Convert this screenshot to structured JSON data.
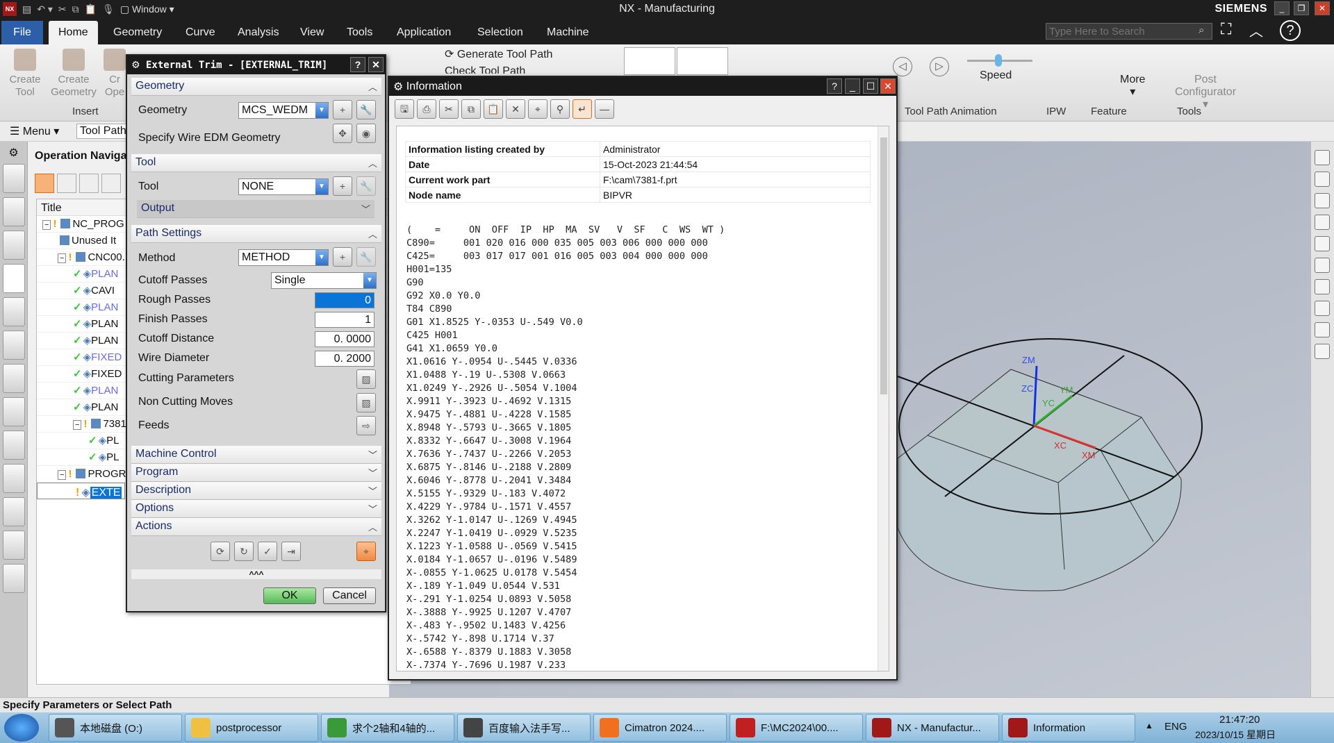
{
  "window": {
    "title": "NX - Manufacturing",
    "brand": "SIEMENS",
    "quick_access_window": "Window"
  },
  "menu_tabs": [
    "File",
    "Home",
    "Geometry",
    "Curve",
    "Analysis",
    "View",
    "Tools",
    "Application",
    "Selection",
    "Machine"
  ],
  "active_tab": "Home",
  "search": {
    "placeholder": "Type Here to Search"
  },
  "ribbon": {
    "create_tool": "Create Tool",
    "create_geometry": "Create Geometry",
    "create_operation": "Cr Ope",
    "insert_group": "Insert",
    "generate_tool_path": "Generate Tool Path",
    "check_tool_path": "Check Tool Path",
    "speed": "Speed",
    "more": "More",
    "post_configurator": "Post Configurator",
    "groups": {
      "animation": "Tool Path Animation",
      "ipw": "IPW",
      "feature": "Feature",
      "tools": "Tools"
    }
  },
  "menubar": {
    "menu": "Menu",
    "filter": "Tool Path"
  },
  "navigator": {
    "title": "Operation Naviga",
    "column": "Title",
    "rows": [
      {
        "label": "NC_PROG",
        "indent": 0,
        "type": "folder",
        "status": "warn"
      },
      {
        "label": "Unused It",
        "indent": 1,
        "type": "folder",
        "status": ""
      },
      {
        "label": "CNC00.",
        "indent": 1,
        "type": "folder",
        "status": "warn"
      },
      {
        "label": "PLAN",
        "indent": 2,
        "type": "op",
        "status": "ok",
        "color": "blue"
      },
      {
        "label": "CAVI",
        "indent": 2,
        "type": "op",
        "status": "ok",
        "color": ""
      },
      {
        "label": "PLAN",
        "indent": 2,
        "type": "op",
        "status": "ok",
        "color": "blue"
      },
      {
        "label": "PLAN",
        "indent": 2,
        "type": "op",
        "status": "ok",
        "color": ""
      },
      {
        "label": "PLAN",
        "indent": 2,
        "type": "op",
        "status": "ok",
        "color": ""
      },
      {
        "label": "FIXED",
        "indent": 2,
        "type": "op",
        "status": "ok",
        "color": "blue"
      },
      {
        "label": "FIXED",
        "indent": 2,
        "type": "op",
        "status": "ok",
        "color": ""
      },
      {
        "label": "PLAN",
        "indent": 2,
        "type": "op",
        "status": "ok",
        "color": "blue"
      },
      {
        "label": "PLAN",
        "indent": 2,
        "type": "op",
        "status": "ok",
        "color": ""
      },
      {
        "label": "7381",
        "indent": 2,
        "type": "folder",
        "status": "warn"
      },
      {
        "label": "PL",
        "indent": 3,
        "type": "op",
        "status": "ok",
        "color": ""
      },
      {
        "label": "PL",
        "indent": 3,
        "type": "op",
        "status": "ok",
        "color": ""
      },
      {
        "label": "PROGRA",
        "indent": 1,
        "type": "folder",
        "status": "warn"
      },
      {
        "label": "EXTE",
        "indent": 2,
        "type": "op",
        "status": "warn",
        "color": "selected"
      }
    ]
  },
  "trim_dialog": {
    "title": "External Trim - [EXTERNAL_TRIM]",
    "sections": {
      "geometry": "Geometry",
      "tool": "Tool",
      "path_settings": "Path Settings",
      "machine_control": "Machine Control",
      "program": "Program",
      "description": "Description",
      "options": "Options",
      "actions": "Actions"
    },
    "geometry_label": "Geometry",
    "geometry_value": "MCS_WEDM",
    "specify_wire": "Specify Wire EDM Geometry",
    "tool_label": "Tool",
    "tool_value": "NONE",
    "output": "Output",
    "method_label": "Method",
    "method_value": "METHOD",
    "cutoff_passes_label": "Cutoff Passes",
    "cutoff_passes_value": "Single",
    "rough_passes_label": "Rough Passes",
    "rough_passes_value": "0",
    "finish_passes_label": "Finish Passes",
    "finish_passes_value": "1",
    "cutoff_distance_label": "Cutoff Distance",
    "cutoff_distance_value": "0. 0000",
    "wire_diameter_label": "Wire Diameter",
    "wire_diameter_value": "0. 2000",
    "cutting_parameters": "Cutting Parameters",
    "non_cutting_moves": "Non Cutting Moves",
    "feeds": "Feeds",
    "ok": "OK",
    "cancel": "Cancel"
  },
  "info_window": {
    "title": "Information",
    "header": [
      {
        "key": "Information listing created by",
        "value": "Administrator"
      },
      {
        "key": "Date",
        "value": "15-Oct-2023 21:44:54"
      },
      {
        "key": "Current work part",
        "value": "F:\\cam\\7381-f.prt"
      },
      {
        "key": "Node name",
        "value": "BIPVR"
      }
    ],
    "lines": [
      "(    =     ON  OFF  IP  HP  MA  SV   V  SF   C  WS  WT )",
      "C890=     001 020 016 000 035 005 003 006 000 000 000",
      "C425=     003 017 017 001 016 005 003 004 000 000 000",
      "H001=135",
      "G90",
      "G92 X0.0 Y0.0",
      "T84 C890",
      "G01 X1.8525 Y-.0353 U-.549 V0.0",
      "C425 H001",
      "G41 X1.0659 Y0.0",
      "X1.0616 Y-.0954 U-.5445 V.0336",
      "X1.0488 Y-.19 U-.5308 V.0663",
      "X1.0249 Y-.2926 U-.5054 V.1004",
      "X.9911 Y-.3923 U-.4692 V.1315",
      "X.9475 Y-.4881 U-.4228 V.1585",
      "X.8948 Y-.5793 U-.3665 V.1805",
      "X.8332 Y-.6647 U-.3008 V.1964",
      "X.7636 Y-.7437 U-.2266 V.2053",
      "X.6875 Y-.8146 U-.2188 V.2809",
      "X.6046 Y-.8778 U-.2041 V.3484",
      "X.5155 Y-.9329 U-.183 V.4072",
      "X.4229 Y-.9784 U-.1571 V.4557",
      "X.3262 Y-1.0147 U-.1269 V.4945",
      "X.2247 Y-1.0419 U-.0929 V.5235",
      "X.1223 Y-1.0588 U-.0569 V.5415",
      "X.0184 Y-1.0657 U-.0196 V.5489",
      "X-.0855 Y-1.0625 U.0178 V.5454",
      "X-.189 Y-1.049 U.0544 V.531",
      "X-.291 Y-1.0254 U.0893 V.5058",
      "X-.3888 Y-.9925 U.1207 V.4707",
      "X-.483 Y-.9502 U.1483 V.4256",
      "X-.5742 Y-.898 U.1714 V.37",
      "X-.6588 Y-.8379 U.1883 V.3058",
      "X-.7374 Y-.7696 U.1987 V.233"
    ]
  },
  "viewport": {
    "axes": {
      "zm": "ZM",
      "zc": "ZC",
      "yc": "YC",
      "ym": "YM",
      "xc": "XC",
      "xm": "XM"
    }
  },
  "status": "Specify Parameters or Select Path",
  "taskbar": {
    "items": [
      "本地磁盘 (O:)",
      "postprocessor",
      "求个2轴和4轴的...",
      "百度输入法手写...",
      "Cimatron 2024....",
      "F:\\MC2024\\00....",
      "NX - Manufactur...",
      "Information"
    ],
    "lang": "ENG",
    "time": "21:47:20",
    "date": "2023/10/15 星期日"
  },
  "colors": {
    "accent": "#0a74d8",
    "file_tab": "#2c5fa8",
    "ok_green": "#6cc46c",
    "title_dark": "#1e1e1e"
  }
}
